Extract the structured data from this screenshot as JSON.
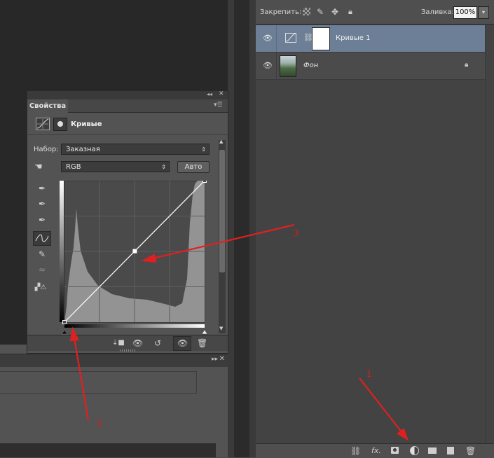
{
  "layers_panel": {
    "lock_label": "Закрепить:",
    "fill_label": "Заливка:",
    "fill_value": "100%",
    "layers": [
      {
        "name": "Кривые 1",
        "selected": true
      },
      {
        "name": "Фон",
        "locked": true
      }
    ]
  },
  "properties_panel": {
    "tab_title": "Свойства",
    "adjustment_title": "Кривые",
    "preset_label": "Набор:",
    "preset_value": "Заказная",
    "channel_value": "RGB",
    "auto_button": "Авто"
  },
  "curve": {
    "input_range": [
      0,
      255
    ],
    "output_range": [
      0,
      255
    ],
    "points": [
      [
        0,
        0
      ],
      [
        128,
        128
      ],
      [
        255,
        255
      ]
    ]
  },
  "annotations": {
    "marker_1": "1",
    "marker_2": "2",
    "marker_3": "3",
    "arrow_color": "#e02020"
  },
  "colors": {
    "selected_layer": "#6d7f96",
    "panel_bg": "#535353"
  },
  "icons": {
    "link": "link-icon",
    "fx": "fx-icon",
    "mask": "add-mask-icon",
    "adjustment": "new-adjustment-icon",
    "group": "folder-icon",
    "new_layer": "new-layer-icon",
    "trash": "trash-icon"
  }
}
